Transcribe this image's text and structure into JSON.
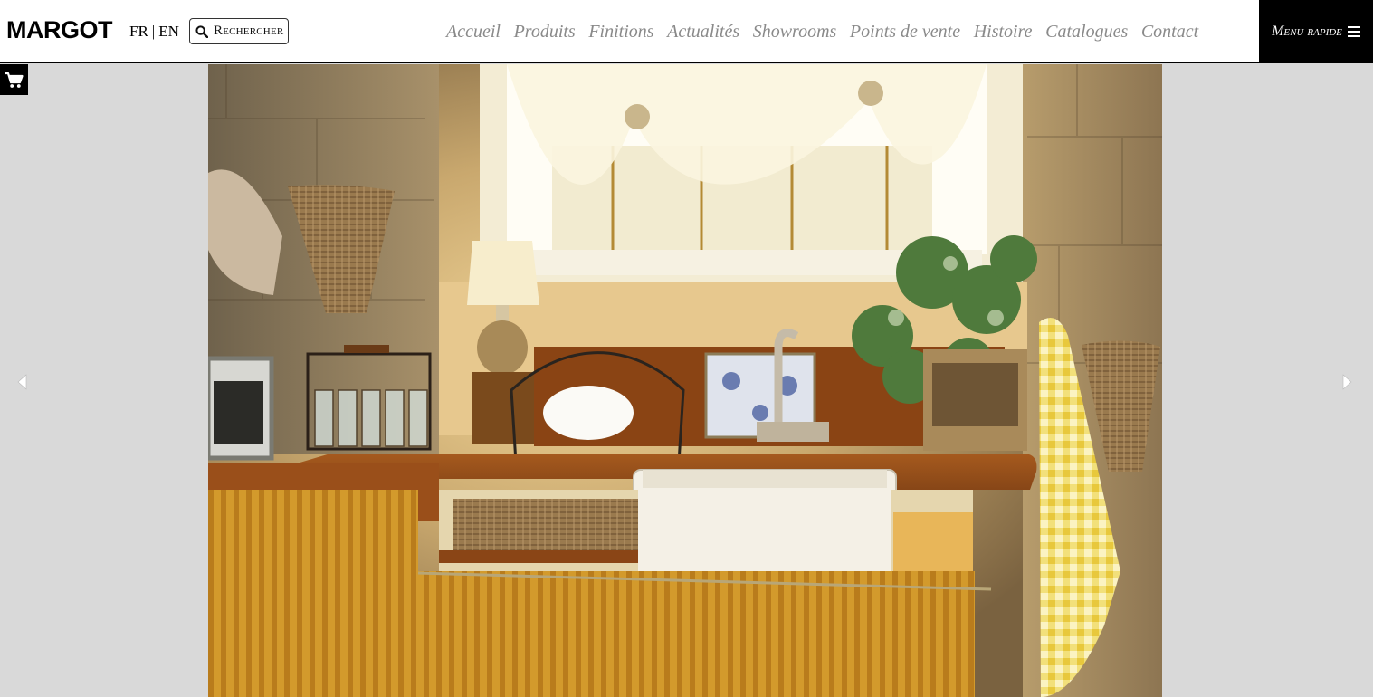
{
  "header": {
    "logo": "MARGOT",
    "lang_fr": "FR",
    "lang_sep": "|",
    "lang_en": "EN",
    "search_label": "Rechercher",
    "nav": [
      "Accueil",
      "Produits",
      "Finitions",
      "Actualités",
      "Showrooms",
      "Points de vente",
      "Histoire",
      "Catalogues",
      "Contact"
    ],
    "menu_rapide": "Menu rapide"
  },
  "icons": {
    "search": "search-icon",
    "cart": "cart-icon",
    "menu": "hamburger-icon",
    "prev": "arrow-left-icon",
    "next": "arrow-right-icon"
  },
  "colors": {
    "nav_text": "#8a8a8a",
    "menu_bg": "#000000",
    "page_bg": "#d9d9d9"
  }
}
